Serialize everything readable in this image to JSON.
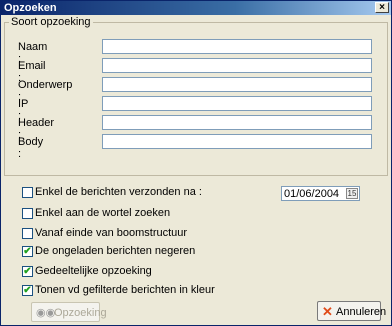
{
  "window": {
    "title": "Opzoeken",
    "close_glyph": "×"
  },
  "group": {
    "legend": "Soort opzoeking",
    "fields": [
      {
        "label": "Naam :",
        "value": ""
      },
      {
        "label": "Email :",
        "value": ""
      },
      {
        "label": "Onderwerp :",
        "value": ""
      },
      {
        "label": "IP :",
        "value": ""
      },
      {
        "label": "Header :",
        "value": ""
      },
      {
        "label": "Body :",
        "value": ""
      }
    ]
  },
  "options": [
    {
      "label": "Enkel de berichten verzonden na :",
      "checked": false
    },
    {
      "label": "Enkel aan de wortel zoeken",
      "checked": false
    },
    {
      "label": "Vanaf einde van boomstructuur",
      "checked": false
    },
    {
      "label": "De ongeladen berichten negeren",
      "checked": true
    },
    {
      "label": "Gedeeltelijke opzoeking",
      "checked": true
    },
    {
      "label": "Tonen vd gefilterde berichten in kleur",
      "checked": true
    }
  ],
  "date": {
    "value": "01/06/2004",
    "calendar_icon": "calendar-icon"
  },
  "buttons": {
    "search_label": "Opzoeking",
    "search_icon": "binoculars-icon",
    "cancel_label": "Annuleren",
    "cancel_icon": "x-icon"
  }
}
